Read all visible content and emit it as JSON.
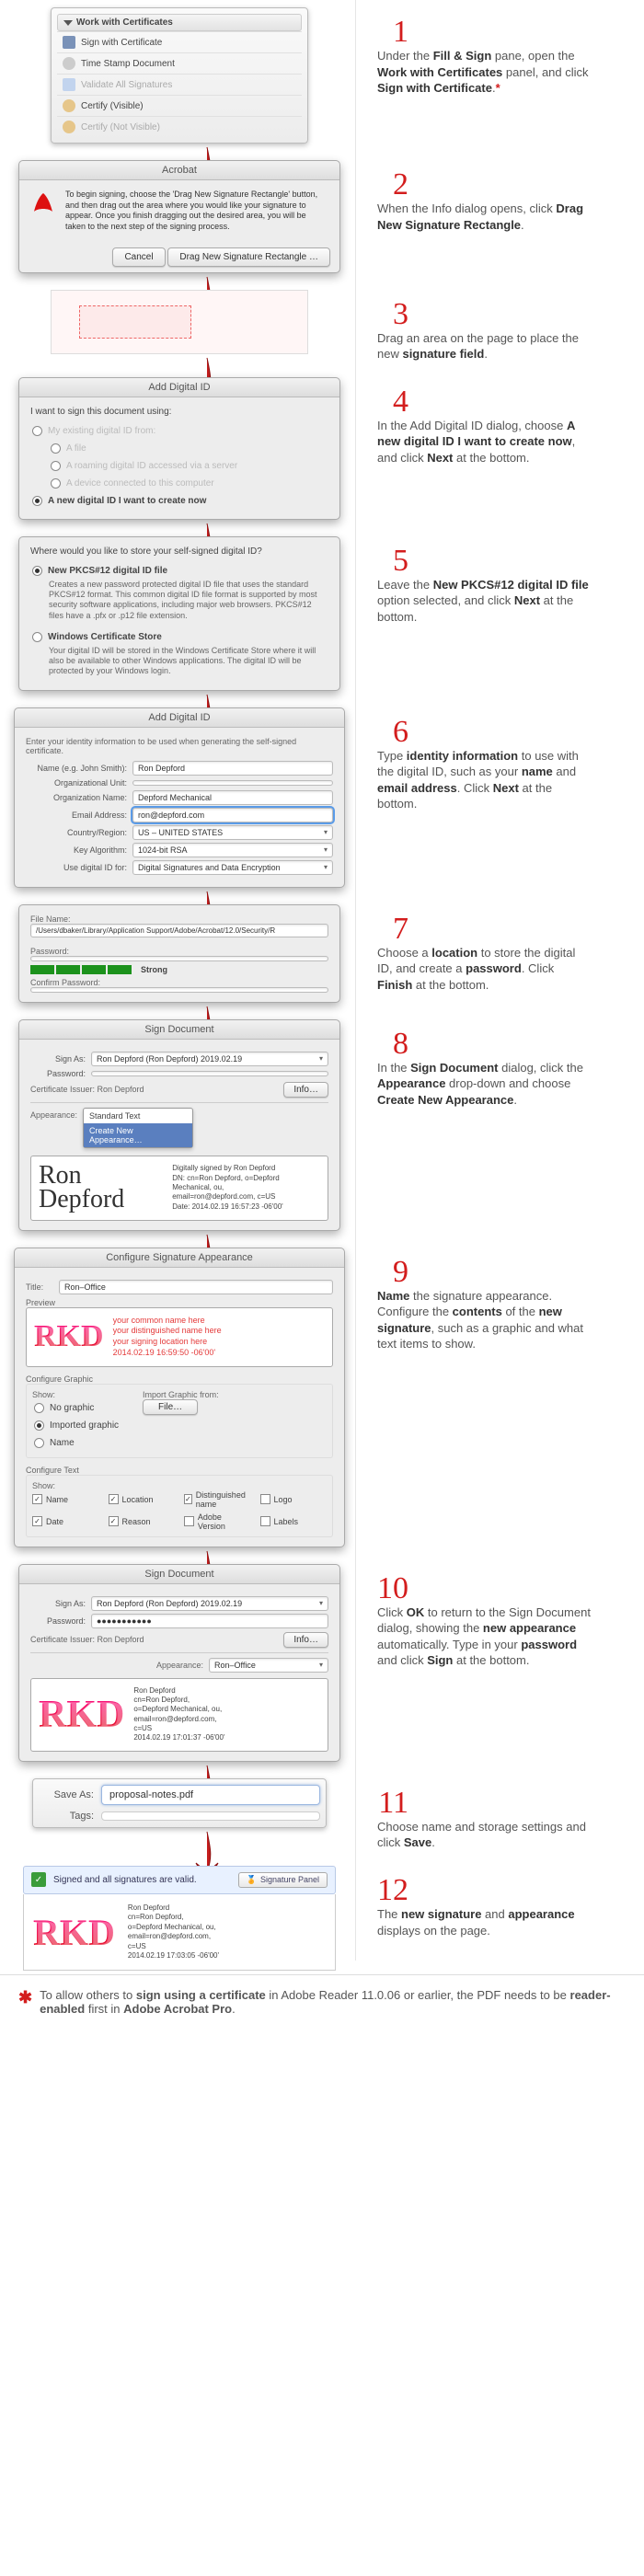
{
  "step1": {
    "panel_title": "Work with Certificates",
    "items": [
      "Sign with Certificate",
      "Time Stamp Document",
      "Validate All Signatures",
      "Certify (Visible)",
      "Certify (Not Visible)"
    ],
    "num": "1",
    "text_pre": "Under the ",
    "b1": "Fill & Sign",
    "text_mid1": " pane, open the ",
    "b2": "Work with Certificates",
    "text_mid2": " panel, and click ",
    "b3": "Sign with Certificate",
    "text_end": "."
  },
  "step2": {
    "title": "Acrobat",
    "info": "To begin signing, choose the 'Drag New Signature Rectangle' button, and then drag out the area where you would like your signature to appear. Once you finish dragging out the desired area, you will be taken to the next step of the signing process.",
    "cancel": "Cancel",
    "drag": "Drag New Signature Rectangle …",
    "num": "2",
    "text_pre": "When the Info dialog opens, click ",
    "b1": "Drag New Signature Rectangle",
    "text_end": "."
  },
  "step3": {
    "num": "3",
    "text_pre": "Drag an area on the page to place the new ",
    "b1": "signature field",
    "text_end": "."
  },
  "step4": {
    "title": "Add Digital ID",
    "lead": "I want to sign this document using:",
    "opts": [
      "My existing digital ID from:",
      "A file",
      "A roaming digital ID accessed via a server",
      "A device connected to this computer",
      "A new digital ID I want to create now"
    ],
    "num": "4",
    "text_pre": "In the Add Digital ID dialog, choose ",
    "b1": "A new digital ID I want to create now",
    "text_mid": ", and click ",
    "b2": "Next",
    "text_end": " at the bottom."
  },
  "step5": {
    "lead": "Where would you like to store your self-signed digital ID?",
    "opt1": "New PKCS#12 digital ID file",
    "opt1desc": "Creates a new password protected digital ID file that uses the standard PKCS#12 format. This common digital ID file format is supported by most security software applications, including major web browsers. PKCS#12 files have a .pfx or .p12 file extension.",
    "opt2": "Windows Certificate Store",
    "opt2desc": "Your digital ID will be stored in the Windows Certificate Store where it will also be available to other Windows applications. The digital ID will be protected by your Windows login.",
    "num": "5",
    "text_pre": "Leave the ",
    "b1": "New PKCS#12 digital ID file",
    "text_mid": " option selected, and click ",
    "b2": "Next",
    "text_end": " at the bottom."
  },
  "step6": {
    "title": "Add Digital ID",
    "lead": "Enter your identity information to be used when generating the self-signed certificate.",
    "fields": {
      "name_l": "Name (e.g. John Smith):",
      "name_v": "Ron Depford",
      "orgu_l": "Organizational Unit:",
      "orgu_v": "",
      "org_l": "Organization Name:",
      "org_v": "Depford Mechanical",
      "email_l": "Email Address:",
      "email_v": "ron@depford.com",
      "country_l": "Country/Region:",
      "country_v": "US – UNITED STATES",
      "alg_l": "Key Algorithm:",
      "alg_v": "1024-bit RSA",
      "use_l": "Use digital ID for:",
      "use_v": "Digital Signatures and Data Encryption"
    },
    "num": "6",
    "text_pre": "Type ",
    "b1": "identity information",
    "text_mid1": " to use with the digital ID, such as your ",
    "b2": "name",
    "text_mid2": " and ",
    "b3": "email address",
    "text_mid3": ". Click ",
    "b4": "Next",
    "text_end": " at the bottom."
  },
  "step7": {
    "filename_l": "File Name:",
    "filename_v": "/Users/dbaker/Library/Application Support/Adobe/Acrobat/12.0/Security/R",
    "pw_l": "Password:",
    "strength": "Strong",
    "confirm_l": "Confirm Password:",
    "num": "7",
    "text_pre": "Choose a ",
    "b1": "location",
    "text_mid1": " to store the digital ID, and create a ",
    "b2": "password",
    "text_mid2": ". Click ",
    "b3": "Finish",
    "text_end": " at the bottom."
  },
  "step8": {
    "title": "Sign Document",
    "signas_l": "Sign As:",
    "signas_v": "Ron Depford (Ron Depford) 2019.02.19",
    "pw_l": "Password:",
    "issuer_l": "Certificate Issuer: Ron Depford",
    "info": "Info…",
    "appearance_l": "Appearance:",
    "dropdown_opts": [
      "Standard Text",
      "Create New Appearance…"
    ],
    "sig_name": "Ron Depford",
    "sig_details": "Digitally signed by Ron Depford\nDN: cn=Ron Depford, o=Depford Mechanical, ou,\nemail=ron@depford.com, c=US\nDate: 2014.02.19 16:57:23 -06'00'",
    "num": "8",
    "text_pre": "In the ",
    "b1": "Sign Document",
    "text_mid1": " dialog, click the ",
    "b2": "Appearance",
    "text_mid2": " drop-down and choose ",
    "b3": "Create New Appearance",
    "text_end": "."
  },
  "step9": {
    "title": "Configure Signature Appearance",
    "titlefield_l": "Title:",
    "titlefield_v": "Ron–Office",
    "preview_l": "Preview",
    "rkd": "RKD",
    "preview_right": "your common name here\nyour distinguished name here\nyour signing location here\n2014.02.19 16:59:50 -06'00'",
    "graphic_l": "Configure Graphic",
    "show_l": "Show:",
    "show_opts": [
      "No graphic",
      "Imported graphic",
      "Name"
    ],
    "import_l": "Import Graphic from:",
    "file_btn": "File…",
    "text_l": "Configure Text",
    "text_show_l": "Show:",
    "text_opts": [
      "Name",
      "Location",
      "Distinguished name",
      "Logo",
      "Date",
      "Reason",
      "Adobe Version",
      "Labels"
    ],
    "text_checked": [
      true,
      true,
      true,
      false,
      true,
      true,
      false,
      false
    ],
    "num": "9",
    "b1": "Name",
    "t1": " the signature appearance. Configure the ",
    "b2": "contents",
    "t2": " of the ",
    "b3": "new signature",
    "t3": ", such as a graphic and what text items to show."
  },
  "step10": {
    "title": "Sign Document",
    "signas_l": "Sign As:",
    "signas_v": "Ron Depford (Ron Depford) 2019.02.19",
    "pw_l": "Password:",
    "pw_v": "●●●●●●●●●●●",
    "issuer_l": "Certificate Issuer: Ron Depford",
    "info": "Info…",
    "appearance_l": "Appearance:",
    "appearance_v": "Ron–Office",
    "rkd": "RKD",
    "sig_right": "Ron Depford\ncn=Ron Depford,\no=Depford Mechanical, ou,\nemail=ron@depford.com,\nc=US\n2014.02.19 17:01:37 -06'00'",
    "num": "10",
    "t1": "Click ",
    "b1": "OK",
    "t2": " to return to the Sign Document dialog, showing the ",
    "b2": "new appearance",
    "t3": " automatically. Type in your ",
    "b3": "password",
    "t4": " and click ",
    "b4": "Sign",
    "t5": " at the bottom."
  },
  "step11": {
    "saveas_l": "Save As:",
    "saveas_v": "proposal-notes.pdf",
    "tags_l": "Tags:",
    "num": "11",
    "t1": "Choose name and storage settings and click ",
    "b1": "Save",
    "t2": "."
  },
  "step12": {
    "banner": "Signed and all signatures are valid.",
    "panel_btn": "Signature Panel",
    "rkd": "RKD",
    "right": "Ron Depford\ncn=Ron Depford,\no=Depford Mechanical, ou,\nemail=ron@depford.com,\nc=US\n2014.02.19 17:03:05 -06'00'",
    "num": "12",
    "t1": "The ",
    "b1": "new signature",
    "t2": " and ",
    "b2": "appearance",
    "t3": " displays on the page."
  },
  "footnote": {
    "t1": "To allow others to ",
    "b1": "sign using a certificate",
    "t2": " in Adobe Reader 11.0.06 or earlier, the PDF needs to be ",
    "b2": "reader-enabled",
    "t3": " first in ",
    "b3": "Adobe Acrobat Pro",
    "t4": "."
  }
}
